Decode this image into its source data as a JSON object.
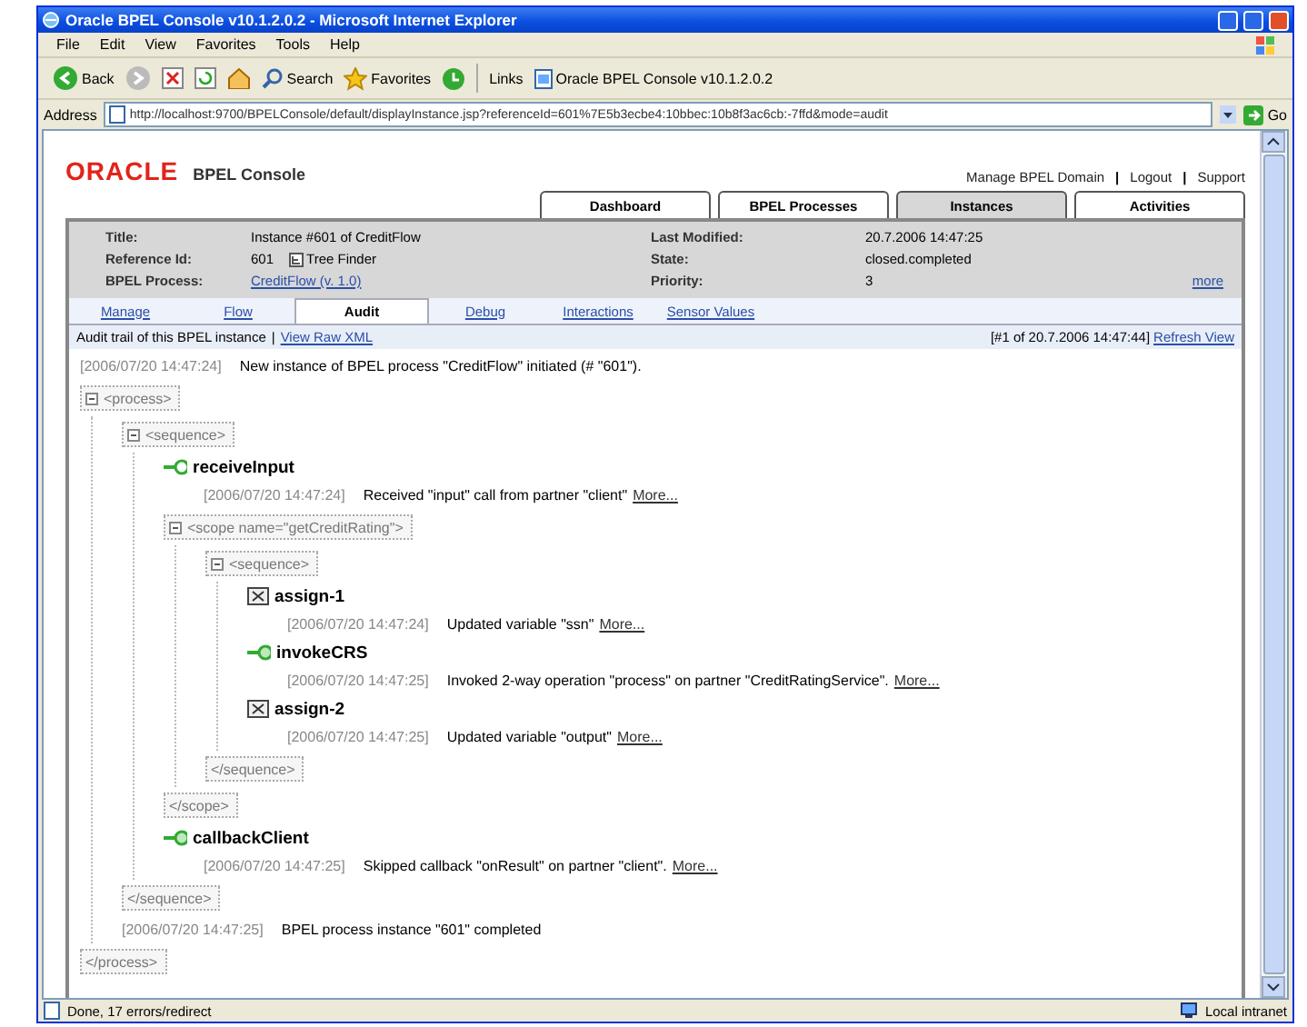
{
  "window": {
    "title": "Oracle BPEL Console v10.1.2.0.2 - Microsoft Internet Explorer"
  },
  "menu": [
    "File",
    "Edit",
    "View",
    "Favorites",
    "Tools",
    "Help"
  ],
  "toolbar": {
    "back": "Back",
    "search": "Search",
    "favorites": "Favorites",
    "links_label": "Links",
    "link": "Oracle BPEL Console v10.1.2.0.2"
  },
  "address": {
    "label": "Address",
    "url": "http://localhost:9700/BPELConsole/default/displayInstance.jsp?referenceId=601%7E5b3ecbe4:10bbec:10b8f3ac6cb:-7ffd&mode=audit",
    "go": "Go"
  },
  "header": {
    "logo": "ORACLE",
    "product": "BPEL Console",
    "items": [
      {
        "kind": "link",
        "text": "Manage BPEL Domain"
      },
      {
        "kind": "separator",
        "text": "|"
      },
      {
        "kind": "link",
        "text": "Logout"
      },
      {
        "kind": "separator",
        "text": "|"
      },
      {
        "kind": "link",
        "text": "Support"
      }
    ]
  },
  "tabs": [
    {
      "label": "Dashboard",
      "selected": false
    },
    {
      "label": "BPEL Processes",
      "selected": false
    },
    {
      "label": "Instances",
      "selected": true
    },
    {
      "label": "Activities",
      "selected": false
    }
  ],
  "info": {
    "left": [
      {
        "label": "Title:",
        "value": "Instance #601 of CreditFlow"
      },
      {
        "label": "Reference Id:",
        "value": "601",
        "extra": "Tree Finder"
      },
      {
        "label": "BPEL Process:",
        "value": "CreditFlow (v. 1.0)",
        "link": true
      }
    ],
    "right": [
      {
        "label": "Last Modified:",
        "value": "20.7.2006 14:47:25"
      },
      {
        "label": "State:",
        "value": "closed.completed"
      },
      {
        "label": "Priority:",
        "value": "3"
      }
    ],
    "more": "more"
  },
  "subtabs": [
    {
      "label": "Manage",
      "selected": false
    },
    {
      "label": "Flow",
      "selected": false
    },
    {
      "label": "Audit",
      "selected": true
    },
    {
      "label": "Debug",
      "selected": false
    },
    {
      "label": "Interactions",
      "selected": false
    },
    {
      "label": "Sensor Values",
      "selected": false
    }
  ],
  "audit": {
    "caption": "Audit trail of this BPEL instance",
    "separator": "|",
    "raw_link": "View Raw XML",
    "position": "[#1 of 20.7.2006 14:47:44]",
    "refresh": "Refresh View",
    "entries": [
      {
        "kind": "log",
        "time": "[2006/07/20 14:47:24]",
        "text": "New instance of BPEL process \"CreditFlow\" initiated (# \"601\")."
      },
      {
        "kind": "block",
        "open": "<process>",
        "close": "</process>",
        "children": [
          {
            "kind": "block",
            "open": "<sequence>",
            "close": "</sequence>",
            "children": [
              {
                "kind": "receive",
                "name": "receiveInput",
                "children": [
                  {
                    "kind": "log",
                    "time": "[2006/07/20 14:47:24]",
                    "text": "Received \"input\" call from partner \"client\"",
                    "more": "More..."
                  }
                ]
              },
              {
                "kind": "block",
                "open": "<scope name=\"getCreditRating\">",
                "close": "</scope>",
                "children": [
                  {
                    "kind": "block",
                    "open": "<sequence>",
                    "close": "</sequence>",
                    "children": [
                      {
                        "kind": "assign",
                        "name": "assign-1",
                        "children": [
                          {
                            "kind": "log",
                            "time": "[2006/07/20 14:47:24]",
                            "text": "Updated variable \"ssn\"",
                            "more": "More..."
                          }
                        ]
                      },
                      {
                        "kind": "invoke",
                        "name": "invokeCRS",
                        "children": [
                          {
                            "kind": "log",
                            "time": "[2006/07/20 14:47:25]",
                            "text": "Invoked 2-way operation \"process\" on partner \"CreditRatingService\".",
                            "more": "More..."
                          }
                        ]
                      },
                      {
                        "kind": "assign",
                        "name": "assign-2",
                        "children": [
                          {
                            "kind": "log",
                            "time": "[2006/07/20 14:47:25]",
                            "text": "Updated variable \"output\"",
                            "more": "More..."
                          }
                        ]
                      }
                    ]
                  }
                ]
              },
              {
                "kind": "invoke",
                "name": "callbackClient",
                "children": [
                  {
                    "kind": "log",
                    "time": "[2006/07/20 14:47:25]",
                    "text": "Skipped callback \"onResult\" on partner \"client\".",
                    "more": "More..."
                  }
                ]
              }
            ]
          },
          {
            "kind": "log",
            "time": "[2006/07/20 14:47:25]",
            "text": "BPEL process instance \"601\" completed"
          }
        ]
      }
    ]
  },
  "status": {
    "text": "Done, 17 errors/redirect",
    "zone": "Local intranet"
  }
}
